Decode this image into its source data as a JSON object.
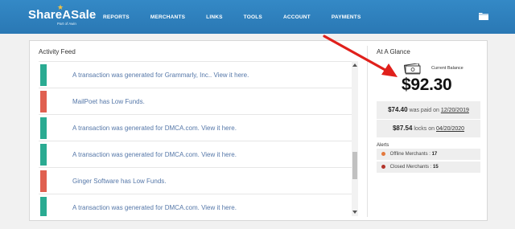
{
  "logo": {
    "name": "ShareASale",
    "tagline": "Part of Awin"
  },
  "nav": {
    "items": [
      "REPORTS",
      "MERCHANTS",
      "LINKS",
      "TOOLS",
      "ACCOUNT",
      "PAYMENTS"
    ],
    "icon": "folder-icon"
  },
  "activity_feed": {
    "title": "Activity Feed",
    "items": [
      {
        "text": "A transaction was generated for Grammarly, Inc.. View it here.",
        "status": "green"
      },
      {
        "text": "MailPoet has Low Funds.",
        "status": "red"
      },
      {
        "text": "A transaction was generated for DMCA.com. View it here.",
        "status": "green"
      },
      {
        "text": "A transaction was generated for DMCA.com. View it here.",
        "status": "green"
      },
      {
        "text": "Ginger Software has Low Funds.",
        "status": "red"
      },
      {
        "text": "A transaction was generated for DMCA.com. View it here.",
        "status": "green"
      }
    ]
  },
  "glance": {
    "title": "At A Glance",
    "balance_label": "Current Balance",
    "balance_value": "$92.30",
    "paid": {
      "amount": "$74.40",
      "text": "was paid on",
      "date": "12/20/2019"
    },
    "locks": {
      "amount": "$87.54",
      "text": "locks on",
      "date": "04/20/2020"
    },
    "alerts_label": "Alerts",
    "alerts": [
      {
        "label": "Offline Merchants :",
        "count": "17",
        "color": "#e3793e"
      },
      {
        "label": "Closed Merchants :",
        "count": "15",
        "color": "#b3352b"
      }
    ]
  },
  "colors": {
    "header": "#2f80bf",
    "success": "#2aab92",
    "danger": "#e06050",
    "annotation": "#e0201b"
  }
}
